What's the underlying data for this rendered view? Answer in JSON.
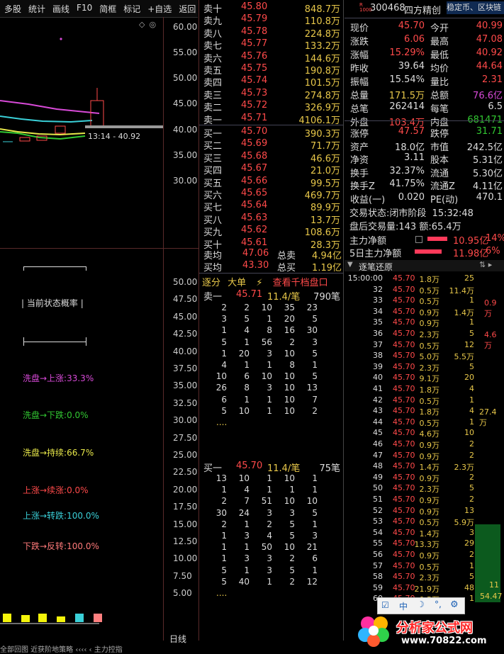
{
  "toolbar": {
    "items": [
      "多股",
      "统计",
      "画线",
      "F10",
      "简框",
      "标记",
      "+自选",
      "返回"
    ]
  },
  "kline": {
    "axis": [
      "60.00",
      "55.00",
      "50.00",
      "45.00",
      "40.00",
      "35.00",
      "30.00"
    ],
    "annotation": "13:14 - 40.92"
  },
  "indicator": {
    "axis": [
      "50.00",
      "47.50",
      "45.00",
      "42.50",
      "40.00",
      "37.50",
      "35.00",
      "32.50",
      "30.00",
      "27.50",
      "25.00",
      "22.50",
      "20.00",
      "17.50",
      "15.00",
      "12.50",
      "10.00",
      "7.50",
      "5.00"
    ],
    "title": "当前状态概率",
    "stats": [
      {
        "text": "洗盘→上涨:33.3%",
        "color": "#d84ad8"
      },
      {
        "text": "洗盘→下跌:0.0%",
        "color": "#32c832"
      },
      {
        "text": "洗盘→持续:66.7%",
        "color": "#e8e84a"
      },
      {
        "text": "上涨→续涨:0.0%",
        "color": "#ff4a4a"
      },
      {
        "text": "上涨→转跌:100.0%",
        "color": "#3ad0d8"
      },
      {
        "text": "下跌→反转:100.0%",
        "color": "#ff7a7a"
      }
    ],
    "period": "日线",
    "bottom_tab": "全部回图  近获阶地策略  ‹‹‹‹  ‹ 主力控指"
  },
  "orderbook": {
    "sells": [
      {
        "label": "卖十",
        "price": "45.80",
        "vol": "848.7万",
        "flag": "¥"
      },
      {
        "label": "卖九",
        "price": "45.79",
        "vol": "110.8万",
        "flag": ""
      },
      {
        "label": "卖八",
        "price": "45.78",
        "vol": "224.8万",
        "flag": ""
      },
      {
        "label": "卖七",
        "price": "45.77",
        "vol": "133.2万",
        "flag": ""
      },
      {
        "label": "卖六",
        "price": "45.76",
        "vol": "144.6万",
        "flag": ""
      },
      {
        "label": "卖五",
        "price": "45.75",
        "vol": "190.8万",
        "flag": ""
      },
      {
        "label": "卖四",
        "price": "45.74",
        "vol": "101.5万",
        "flag": ""
      },
      {
        "label": "卖三",
        "price": "45.73",
        "vol": "274.8万",
        "flag": ""
      },
      {
        "label": "卖二",
        "price": "45.72",
        "vol": "326.9万",
        "flag": ""
      },
      {
        "label": "卖一",
        "price": "45.71",
        "vol": "4106.1万",
        "flag": ""
      }
    ],
    "buys": [
      {
        "label": "买一",
        "price": "45.70",
        "vol": "390.3万"
      },
      {
        "label": "买二",
        "price": "45.69",
        "vol": "71.7万"
      },
      {
        "label": "买三",
        "price": "45.68",
        "vol": "46.6万"
      },
      {
        "label": "买四",
        "price": "45.67",
        "vol": "21.0万"
      },
      {
        "label": "买五",
        "price": "45.66",
        "vol": "99.5万"
      },
      {
        "label": "买六",
        "price": "45.65",
        "vol": "469.7万"
      },
      {
        "label": "买七",
        "price": "45.64",
        "vol": "89.9万"
      },
      {
        "label": "买八",
        "price": "45.63",
        "vol": "13.7万"
      },
      {
        "label": "买九",
        "price": "45.62",
        "vol": "108.6万"
      },
      {
        "label": "买十",
        "price": "45.61",
        "vol": "28.3万"
      }
    ],
    "avg_sell_label": "卖均",
    "avg_sell": "47.06",
    "total_sell_label": "总卖",
    "total_sell": "4.94亿",
    "avg_buy_label": "买均",
    "avg_buy": "43.30",
    "total_buy_label": "总买",
    "total_buy": "1.19亿"
  },
  "queue": {
    "tabs": [
      "逐分",
      "大单",
      "查看千档盘口"
    ],
    "sell_head": {
      "label": "卖一",
      "price": "45.71",
      "per": "11.4/笔",
      "count": "790笔"
    },
    "sell_rows": [
      [
        "2",
        "2",
        "10",
        "35",
        "23"
      ],
      [
        "3",
        "5",
        "1",
        "20",
        "5"
      ],
      [
        "1",
        "4",
        "8",
        "16",
        "30"
      ],
      [
        "5",
        "1",
        "56",
        "2",
        "3"
      ],
      [
        "1",
        "20",
        "3",
        "10",
        "5"
      ],
      [
        "4",
        "1",
        "1",
        "8",
        "1"
      ],
      [
        "10",
        "6",
        "10",
        "10",
        "5"
      ],
      [
        "26",
        "8",
        "3",
        "10",
        "13"
      ],
      [
        "6",
        "1",
        "1",
        "10",
        "7"
      ],
      [
        "5",
        "10",
        "1",
        "10",
        "2"
      ]
    ],
    "buy_head": {
      "label": "买一",
      "price": "45.70",
      "per": "11.4/笔",
      "count": "75笔"
    },
    "buy_rows": [
      [
        "13",
        "10",
        "1",
        "10",
        "1"
      ],
      [
        "1",
        "4",
        "1",
        "1",
        "1"
      ],
      [
        "2",
        "7",
        "51",
        "10",
        "10"
      ],
      [
        "30",
        "24",
        "3",
        "3",
        "5"
      ],
      [
        "2",
        "1",
        "2",
        "5",
        "1"
      ],
      [
        "1",
        "3",
        "4",
        "5",
        "3"
      ],
      [
        "1",
        "1",
        "50",
        "10",
        "21"
      ],
      [
        "1",
        "3",
        "3",
        "2",
        "6"
      ],
      [
        "5",
        "1",
        "3",
        "5",
        "1"
      ],
      [
        "5",
        "40",
        "1",
        "2",
        "12"
      ]
    ],
    "more": "...."
  },
  "quote": {
    "code": "300468",
    "name": "四方精创",
    "tags": "稳定币、区块链",
    "rows": [
      {
        "l1": "现价",
        "v1": "45.70",
        "c1": "red",
        "l2": "今开",
        "v2": "40.99",
        "c2": "red"
      },
      {
        "l1": "涨跌",
        "v1": "6.06",
        "c1": "red",
        "l2": "最高",
        "v2": "47.08",
        "c2": "red"
      },
      {
        "l1": "涨幅",
        "v1": "15.29%",
        "c1": "red",
        "l2": "最低",
        "v2": "40.92",
        "c2": "red"
      },
      {
        "l1": "昨收",
        "v1": "39.64",
        "c1": "wht",
        "l2": "均价",
        "v2": "44.64",
        "c2": "red"
      },
      {
        "l1": "振幅",
        "v1": "15.54%",
        "c1": "wht",
        "l2": "量比",
        "v2": "2.31",
        "c2": "red"
      },
      {
        "l1": "总量",
        "v1": "171.5万",
        "c1": "yel",
        "l2": "总额",
        "v2": "76.6亿",
        "c2": "mag"
      },
      {
        "l1": "总笔",
        "v1": "262414",
        "c1": "wht",
        "l2": "每笔",
        "v2": "6.5",
        "c2": "wht"
      },
      {
        "l1": "外盘",
        "v1": "103.4万",
        "c1": "red",
        "l2": "内盘",
        "v2": "681471",
        "c2": "grn"
      },
      {
        "l1": "涨停",
        "v1": "47.57",
        "c1": "red",
        "l2": "跌停",
        "v2": "31.71",
        "c2": "grn"
      },
      {
        "l1": "资产",
        "v1": "18.0亿",
        "c1": "wht",
        "l2": "市值",
        "v2": "242.5亿",
        "c2": "wht"
      },
      {
        "l1": "净资",
        "v1": "3.11",
        "c1": "wht",
        "l2": "股本",
        "v2": "5.31亿",
        "c2": "wht"
      },
      {
        "l1": "换手",
        "v1": "32.37%",
        "c1": "wht",
        "l2": "流通",
        "v2": "5.30亿",
        "c2": "wht"
      },
      {
        "l1": "换手Z",
        "v1": "41.75%",
        "c1": "wht",
        "l2": "流通Z",
        "v2": "4.11亿",
        "c2": "wht"
      },
      {
        "l1": "收益(一)",
        "v1": "0.020",
        "c1": "wht",
        "l2": "PE(动)",
        "v2": "470.1",
        "c2": "wht"
      }
    ],
    "status_label": "交易状态:",
    "status": "闭市阶段",
    "time": "15:32:48",
    "after_label": "盘后交易量:",
    "after_vol": "143",
    "after_amt_label": "额:",
    "after_amt": "65.4万",
    "flow1_label": "主力净额",
    "flow1": "10.95亿",
    "flow1_pct": "14%",
    "flow2_label": "5日主力净额",
    "flow2": "11.98亿",
    "flow2_pct": "6%",
    "tape_title": "逐笔还原",
    "tape": [
      {
        "t": "15:00:00",
        "p": "45.70",
        "v": "1.8万",
        "n": "25"
      },
      {
        "t": "32",
        "p": "45.70",
        "v": "0.5万",
        "n": "11.4万"
      },
      {
        "t": "33",
        "p": "45.70",
        "v": "0.5万",
        "n": "1"
      },
      {
        "t": "34",
        "p": "45.70",
        "v": "0.9万",
        "n": "1.4万"
      },
      {
        "t": "35",
        "p": "45.70",
        "v": "0.9万",
        "n": "1"
      },
      {
        "t": "36",
        "p": "45.70",
        "v": "2.3万",
        "n": "5"
      },
      {
        "t": "37",
        "p": "45.70",
        "v": "0.5万",
        "n": "12"
      },
      {
        "t": "38",
        "p": "45.70",
        "v": "5.0万",
        "n": "5.5万"
      },
      {
        "t": "39",
        "p": "45.70",
        "v": "2.3万",
        "n": "5"
      },
      {
        "t": "40",
        "p": "45.70",
        "v": "9.1万",
        "n": "20"
      },
      {
        "t": "41",
        "p": "45.70",
        "v": "1.8万",
        "n": "4"
      },
      {
        "t": "42",
        "p": "45.70",
        "v": "0.5万",
        "n": "1"
      },
      {
        "t": "43",
        "p": "45.70",
        "v": "1.8万",
        "n": "4"
      },
      {
        "t": "44",
        "p": "45.70",
        "v": "0.5万",
        "n": "1"
      },
      {
        "t": "45",
        "p": "45.70",
        "v": "4.6万",
        "n": "10"
      },
      {
        "t": "46",
        "p": "45.70",
        "v": "0.9万",
        "n": "2"
      },
      {
        "t": "47",
        "p": "45.70",
        "v": "0.9万",
        "n": "2"
      },
      {
        "t": "48",
        "p": "45.70",
        "v": "1.4万",
        "n": "2.3万"
      },
      {
        "t": "49",
        "p": "45.70",
        "v": "0.9万",
        "n": "2"
      },
      {
        "t": "50",
        "p": "45.70",
        "v": "2.3万",
        "n": "5"
      },
      {
        "t": "51",
        "p": "45.70",
        "v": "0.9万",
        "n": "2"
      },
      {
        "t": "52",
        "p": "45.70",
        "v": "0.9万",
        "n": "13"
      },
      {
        "t": "53",
        "p": "45.70",
        "v": "0.5万",
        "n": "5.9万"
      },
      {
        "t": "54",
        "p": "45.70",
        "v": "1.4万",
        "n": "3"
      },
      {
        "t": "55",
        "p": "45.70",
        "v": "13.3万",
        "n": "29"
      },
      {
        "t": "56",
        "p": "45.70",
        "v": "0.9万",
        "n": "2"
      },
      {
        "t": "57",
        "p": "45.70",
        "v": "0.5万",
        "n": "1"
      },
      {
        "t": "58",
        "p": "45.70",
        "v": "2.3万",
        "n": "5"
      },
      {
        "t": "59",
        "p": "45.70",
        "v": "21.9万",
        "n": "48"
      },
      {
        "t": "60",
        "p": "45.70",
        "v": "0.5万",
        "n": "1"
      }
    ],
    "side_vals": [
      "0.9万",
      "4.6万",
      "27.4万",
      "11",
      "54.47"
    ]
  },
  "watermark": {
    "site": "分析家公式网",
    "url": "www.70822.com"
  }
}
